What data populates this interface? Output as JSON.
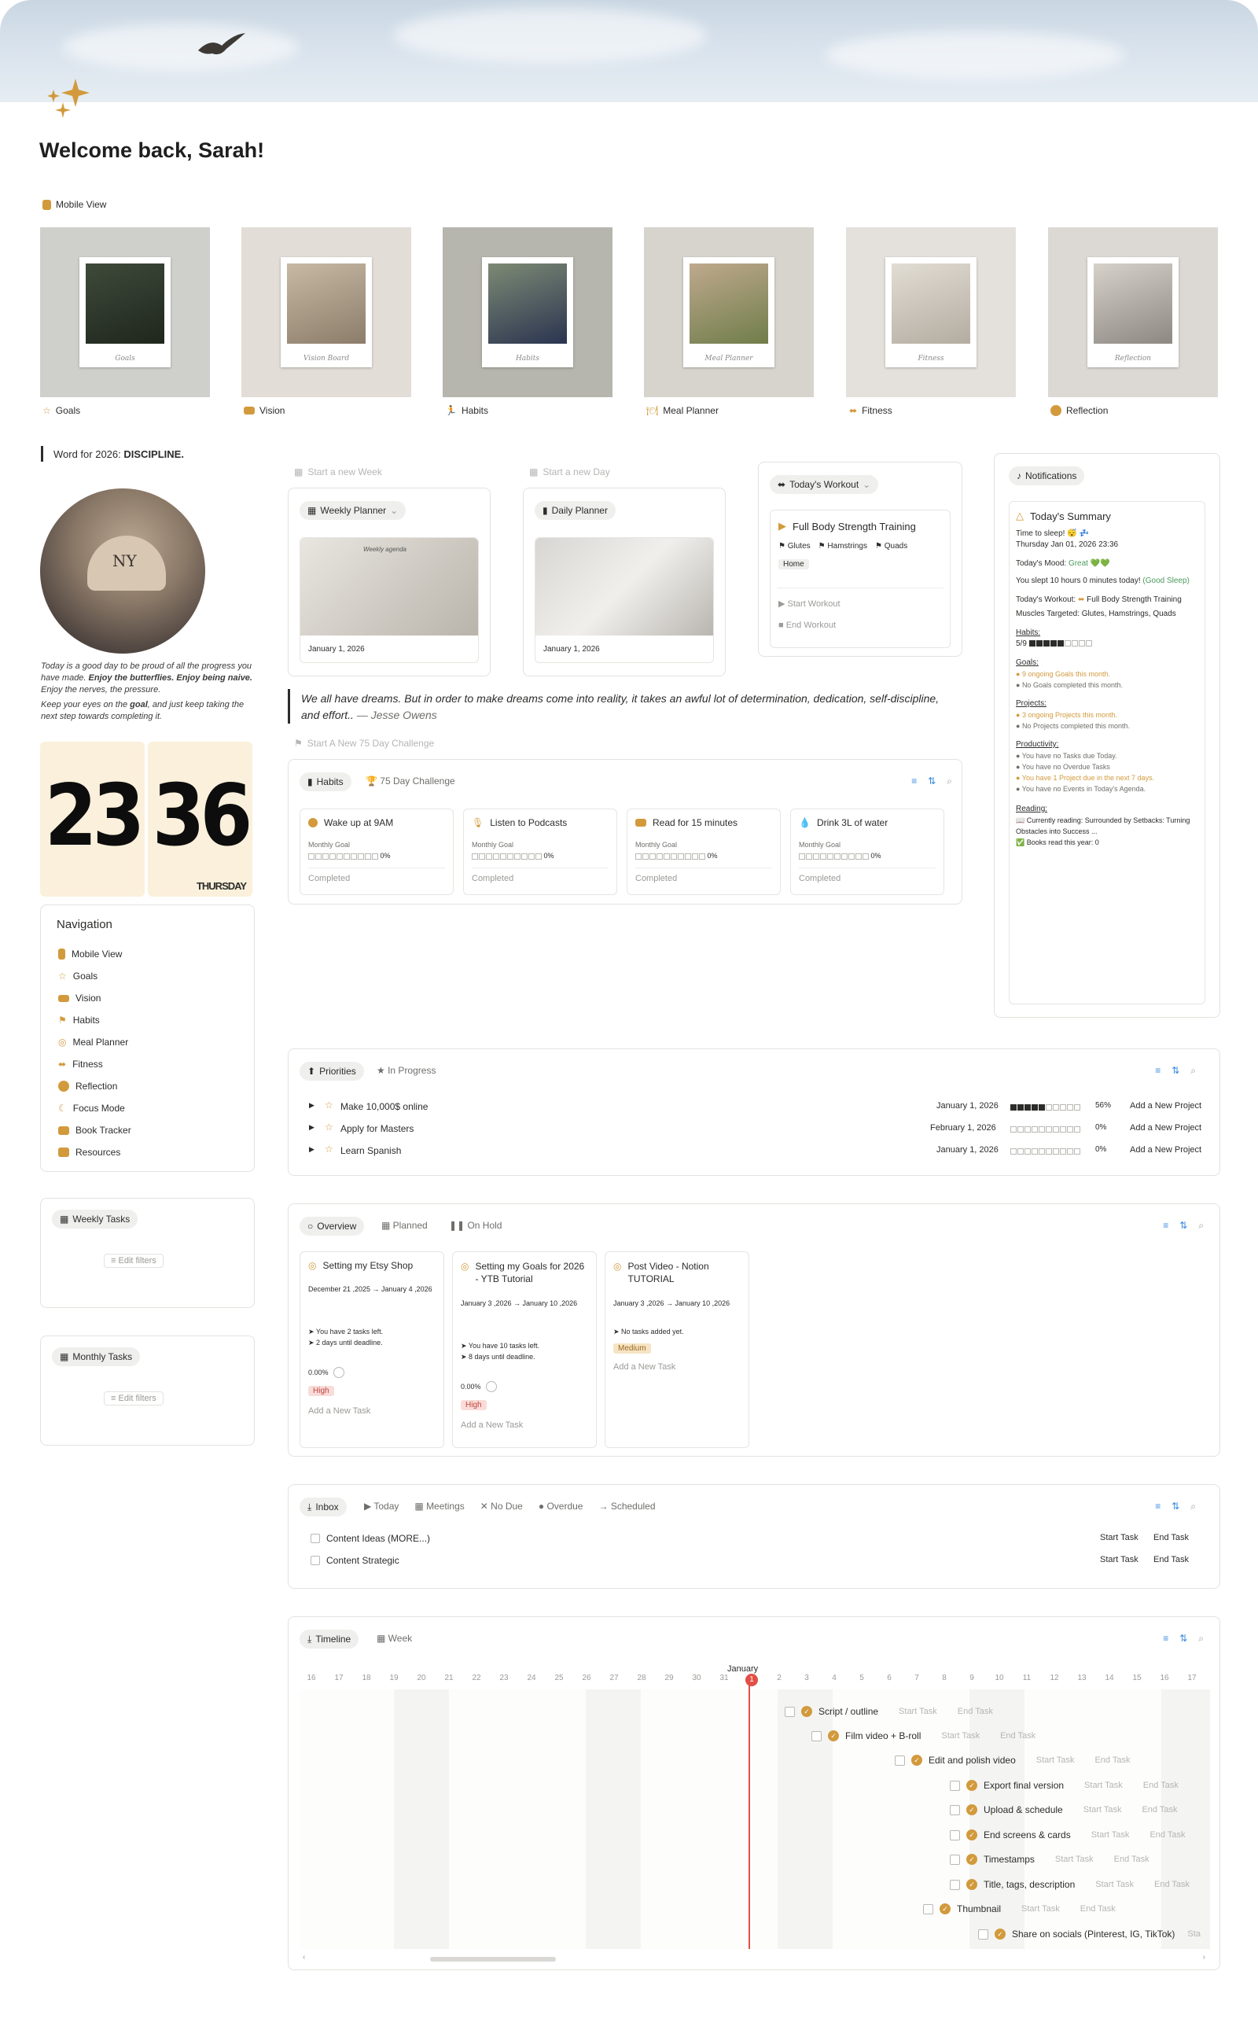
{
  "welcome": "Welcome back, Sarah!",
  "mobile_view": "Mobile View",
  "gallery": [
    {
      "label": "Goals",
      "caption": "Goals",
      "icon": "star-icon",
      "color": "#c8983c"
    },
    {
      "label": "Vision",
      "caption": "Vision Board",
      "icon": "tv-icon",
      "color": "#c8983c"
    },
    {
      "label": "Habits",
      "caption": "Habits",
      "icon": "run-icon",
      "color": "#c8983c"
    },
    {
      "label": "Meal Planner",
      "caption": "Meal Planner",
      "icon": "meal-icon",
      "color": "#c8983c"
    },
    {
      "label": "Fitness",
      "caption": "Fitness",
      "icon": "dumbbell-icon",
      "color": "#c8983c"
    },
    {
      "label": "Reflection",
      "caption": "Reflection",
      "icon": "leaf-icon",
      "color": "#c8983c"
    }
  ],
  "word_of_year": {
    "prefix": "Word for 2026:",
    "word": "DISCIPLINE."
  },
  "quote_left": {
    "p1a": "Today is a good day to be proud of all the progress you have made. ",
    "p1b": "Enjoy the butterflies.",
    "p1c": " ",
    "p1d": "Enjoy being naive.",
    "p1e": " Enjoy the nerves, the pressure.",
    "p2a": "Keep your eyes on the ",
    "p2b": "goal",
    "p2c": ", and just keep taking the next step towards completing it."
  },
  "clock": {
    "hours": "23",
    "minutes": "36",
    "day": "THURSDAY"
  },
  "navigation": {
    "title": "Navigation",
    "items": [
      "Mobile View",
      "Goals",
      "Vision",
      "Habits",
      "Meal Planner",
      "Fitness",
      "Reflection",
      "Focus Mode",
      "Book Tracker",
      "Resources"
    ]
  },
  "weekly_tasks": {
    "title": "Weekly Tasks",
    "edit": "Edit filters"
  },
  "monthly_tasks": {
    "title": "Monthly Tasks",
    "edit": "Edit filters"
  },
  "planners": {
    "start_week": "Start a new Week",
    "start_day": "Start a new Day",
    "weekly": {
      "title": "Weekly Planner",
      "date": "January 1, 2026",
      "sheet": "Weekly agenda"
    },
    "daily": {
      "title": "Daily Planner",
      "date": "January 1, 2026"
    }
  },
  "workout": {
    "title": "Today's Workout",
    "name": "Full Body Strength Training",
    "muscles": [
      "Glutes",
      "Hamstrings",
      "Quads"
    ],
    "tag": "Home",
    "start": "Start Workout",
    "end": "End Workout"
  },
  "quote_main": {
    "text": "We all have dreams. But in order to make dreams come into reality, it takes an awful lot of determination, dedication, self-discipline, and effort.. ",
    "author": "— Jesse Owens"
  },
  "challenge_btn": "Start A New 75 Day Challenge",
  "habits": {
    "tab1": "Habits",
    "tab2": "75 Day Challenge",
    "items": [
      {
        "title": "Wake up at 9AM",
        "goal": "Monthly Goal",
        "pct": "0%",
        "status": "Completed"
      },
      {
        "title": "Listen to Podcasts",
        "goal": "Monthly Goal",
        "pct": "0%",
        "status": "Completed"
      },
      {
        "title": "Read for 15 minutes",
        "goal": "Monthly Goal",
        "pct": "0%",
        "status": "Completed"
      },
      {
        "title": "Drink 3L of water",
        "goal": "Monthly Goal",
        "pct": "0%",
        "status": "Completed"
      }
    ]
  },
  "notifications": {
    "tab": "Notifications",
    "title": "Today's Summary",
    "sleep_title": "Time to sleep! 😴 💤",
    "sleep_date": "Thursday Jan 01, 2026 23:36",
    "mood_label": "Today's Mood:",
    "mood_value": "Great 💚💚",
    "slept": "You slept 10 hours 0 minutes today! ",
    "slept_good": "(Good Sleep)",
    "workout_label": "Today's Workout:",
    "workout_value": "Full Body Strength Training",
    "muscles_label": "Muscles Targeted:",
    "muscles_value": "Glutes, Hamstrings, Quads",
    "habits_label": "Habits:",
    "habits_value": "5/9",
    "habits_filled": 5,
    "habits_total": 9,
    "goals_label": "Goals:",
    "goals_1": "9 ongoing Goals this month.",
    "goals_2": "No Goals completed this month.",
    "projects_label": "Projects:",
    "projects_1": "3 ongoing Projects this month.",
    "projects_2": "No Projects completed this month.",
    "productivity_label": "Productivity:",
    "prod_1": "You have no Tasks due Today.",
    "prod_2": "You have no Overdue Tasks",
    "prod_3": "You have 1 Project due in the next 7 days.",
    "prod_4": "You have no Events in Today's Agenda.",
    "reading_label": "Reading:",
    "reading_1": "Currently reading: Surrounded by Setbacks: Turning Obstacles into Success ...",
    "reading_2": "Books read this year: 0"
  },
  "priorities": {
    "tab1": "Priorities",
    "tab2": "In Progress",
    "rows": [
      {
        "name": "Make 10,000$ online",
        "date": "January 1, 2026",
        "pct": "56%",
        "filled": 5,
        "add": "Add a New Project"
      },
      {
        "name": "Apply for Masters",
        "date": "February 1, 2026",
        "pct": "0%",
        "filled": 0,
        "add": "Add a New Project"
      },
      {
        "name": "Learn Spanish",
        "date": "January 1, 2026",
        "pct": "0%",
        "filled": 0,
        "add": "Add a New Project"
      }
    ]
  },
  "projects": {
    "tab1": "Overview",
    "tab2": "Planned",
    "tab3": "On Hold",
    "cards": [
      {
        "title": "Setting my Etsy Shop",
        "dates": "December 21 ,2025 → January 4 ,2026",
        "l1": "You have 2 tasks left.",
        "l2": "2 days until deadline.",
        "pct": "0.00%",
        "prio": "High",
        "add": "Add a New Task"
      },
      {
        "title": "Setting my Goals for 2026 - YTB Tutorial",
        "dates": "January 3 ,2026 → January 10 ,2026",
        "l1": "You have 10 tasks left.",
        "l2": "8 days until deadline.",
        "pct": "0.00%",
        "prio": "High",
        "add": "Add a New Task"
      },
      {
        "title": "Post Video - Notion TUTORIAL",
        "dates": "January 3 ,2026 → January 10 ,2026",
        "l1": "No tasks added yet.",
        "l2": "",
        "pct": "",
        "prio": "Medium",
        "add": "Add a New Task"
      }
    ]
  },
  "inbox": {
    "tabs": [
      "Inbox",
      "Today",
      "Meetings",
      "No Due",
      "Overdue",
      "Scheduled"
    ],
    "rows": [
      {
        "name": "Content Ideas (MORE...)",
        "start": "Start Task",
        "end": "End Task"
      },
      {
        "name": "Content Strategic",
        "start": "Start Task",
        "end": "End Task"
      }
    ]
  },
  "timeline": {
    "tab1": "Timeline",
    "tab2": "Week",
    "month": "January",
    "days": [
      "16",
      "17",
      "18",
      "19",
      "20",
      "21",
      "22",
      "23",
      "24",
      "25",
      "26",
      "27",
      "28",
      "29",
      "30",
      "31",
      "1",
      "2",
      "3",
      "4",
      "5",
      "6",
      "7",
      "8",
      "9",
      "10",
      "11",
      "12",
      "13",
      "14",
      "15",
      "16",
      "17"
    ],
    "today": "1",
    "tasks": [
      {
        "name": "Script / outline",
        "start": "Start Task",
        "end": "End Task"
      },
      {
        "name": "Film video + B-roll",
        "start": "Start Task",
        "end": "End Task"
      },
      {
        "name": "Edit and polish video",
        "start": "Start Task",
        "end": "End Task"
      },
      {
        "name": "Export final version",
        "start": "Start Task",
        "end": "End Task"
      },
      {
        "name": "Upload & schedule",
        "start": "Start Task",
        "end": "End Task"
      },
      {
        "name": "End screens & cards",
        "start": "Start Task",
        "end": "End Task"
      },
      {
        "name": "Timestamps",
        "start": "Start Task",
        "end": "End Task"
      },
      {
        "name": "Title, tags, description",
        "start": "Start Task",
        "end": "End Task"
      },
      {
        "name": "Thumbnail",
        "start": "Start Task",
        "end": "End Task"
      },
      {
        "name": "Share on socials (Pinterest, IG, TikTok)",
        "start": "Sta",
        "end": ""
      }
    ]
  },
  "colors": {
    "accent": "#d29a3c",
    "blue": "#3d8ee0",
    "red": "#e24f46"
  }
}
